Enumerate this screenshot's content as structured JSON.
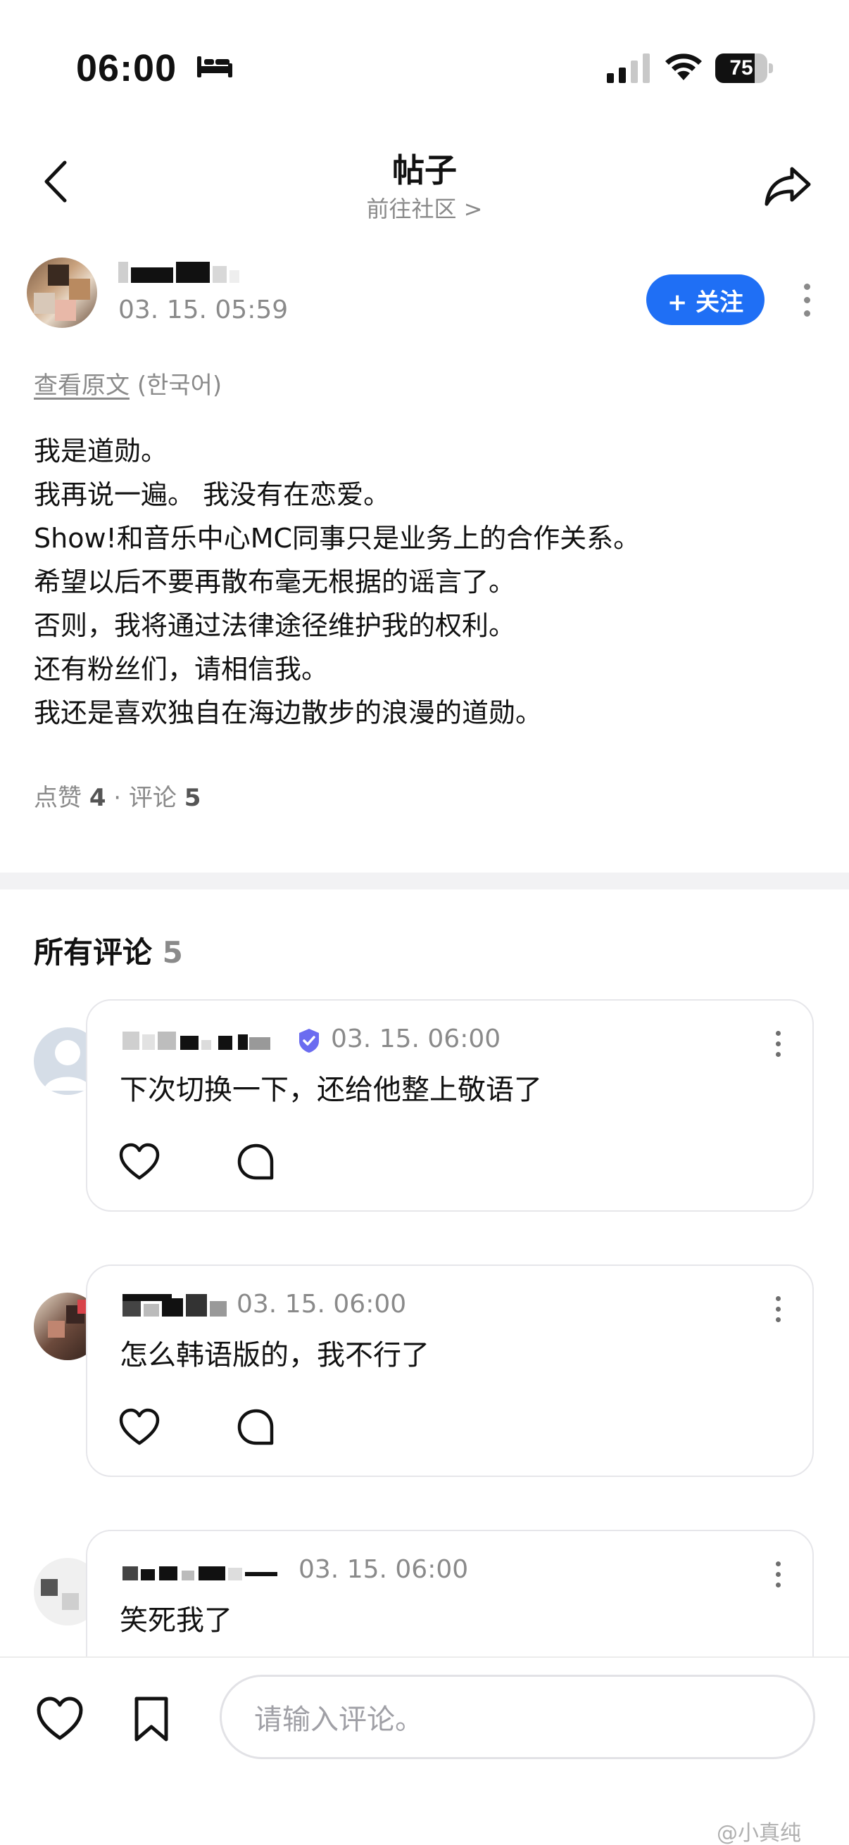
{
  "status_bar": {
    "time": "06:00",
    "battery": "75",
    "battery_level": 0.75
  },
  "header": {
    "title": "帖子",
    "community_link": "前往社区 >"
  },
  "post": {
    "author_time": "03. 15. 05:59",
    "follow_label": "+ 关注",
    "translate_link": "查看原文",
    "translate_lang": "(한국어)",
    "lines": [
      "我是道勋。",
      "我再说一遍。 我没有在恋爱。",
      "Show!和音乐中心MC同事只是业务上的合作关系。",
      "希望以后不要再散布毫无根据的谣言了。",
      "否则，我将通过法律途径维护我的权利。",
      "还有粉丝们，请相信我。",
      "我还是喜欢独自在海边散步的浪漫的道勋。"
    ],
    "likes_label": "点赞",
    "likes": "4",
    "separator": "·",
    "comments_label": "评论",
    "comments": "5"
  },
  "comments_section": {
    "title": "所有评论",
    "count": "5",
    "comments": [
      {
        "time": "03. 15. 06:00",
        "text": "下次切换一下，还给他整上敬语了",
        "verified": true
      },
      {
        "time": "03. 15. 06:00",
        "text": "怎么韩语版的，我不行了",
        "verified": false
      },
      {
        "time": "03. 15. 06:00",
        "text": "笑死我了",
        "verified": false
      }
    ]
  },
  "bottom_bar": {
    "input_placeholder": "请输入评论。"
  },
  "watermark": "@小真纯",
  "colors": {
    "accent": "#1f6ff5",
    "muted": "#8a8a8a",
    "verified": "#6b6cf0"
  },
  "icons": [
    "bed-icon",
    "signal-icon",
    "wifi-icon",
    "back-arrow-icon",
    "share-icon",
    "heart-icon",
    "comment-bubble-icon",
    "bookmark-icon",
    "more-dots-icon",
    "verified-badge-icon"
  ]
}
